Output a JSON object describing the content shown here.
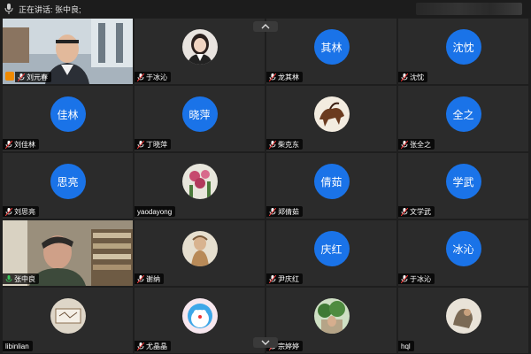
{
  "topbar": {
    "speaking_label": "正在讲话: 张中良;"
  },
  "colors": {
    "avatar_blue": "#1a73e8",
    "speaking_border": "#37c85b",
    "host_badge": "#f08a00",
    "tile_bg": "#2b2b2b"
  },
  "participants": [
    {
      "name": "刘元春",
      "avatar": "",
      "kind": "video"
    },
    {
      "name": "于冰沁",
      "avatar": "",
      "kind": "photo"
    },
    {
      "name": "龙其林",
      "avatar": "其林",
      "kind": "initials"
    },
    {
      "name": "沈忱",
      "avatar": "沈忱",
      "kind": "initials"
    },
    {
      "name": "刘佳林",
      "avatar": "佳林",
      "kind": "initials"
    },
    {
      "name": "丁晓萍",
      "avatar": "晓萍",
      "kind": "initials"
    },
    {
      "name": "柴克东",
      "avatar": "",
      "kind": "photo"
    },
    {
      "name": "张全之",
      "avatar": "全之",
      "kind": "initials"
    },
    {
      "name": "刘思亮",
      "avatar": "思亮",
      "kind": "initials"
    },
    {
      "name": "yaodayong",
      "avatar": "",
      "kind": "photo"
    },
    {
      "name": "郑倩茹",
      "avatar": "倩茹",
      "kind": "initials"
    },
    {
      "name": "文学武",
      "avatar": "学武",
      "kind": "initials"
    },
    {
      "name": "张中良",
      "avatar": "",
      "kind": "video"
    },
    {
      "name": "谢纳",
      "avatar": "",
      "kind": "photo"
    },
    {
      "name": "尹庆红",
      "avatar": "庆红",
      "kind": "initials"
    },
    {
      "name": "于冰沁",
      "avatar": "冰沁",
      "kind": "initials"
    },
    {
      "name": "libinlian",
      "avatar": "",
      "kind": "photo"
    },
    {
      "name": "尤晶晶",
      "avatar": "",
      "kind": "photo"
    },
    {
      "name": "宗婷婷",
      "avatar": "",
      "kind": "photo"
    },
    {
      "name": "hql",
      "avatar": "",
      "kind": "photo"
    }
  ]
}
